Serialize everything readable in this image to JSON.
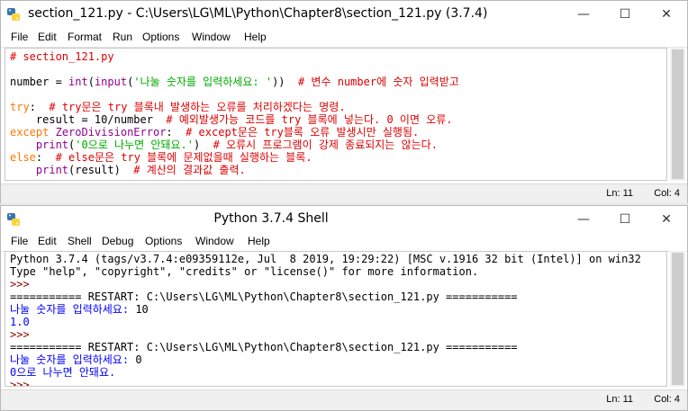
{
  "editor": {
    "title": "section_121.py - C:\\Users\\LG\\ML\\Python\\Chapter8\\section_121.py (3.7.4)",
    "menu": [
      "File",
      "Edit",
      "Format",
      "Run",
      "Options",
      "Window",
      "Help"
    ],
    "code": {
      "l1_cm": "# section_121.py",
      "l3_a": "number = ",
      "l3_bi1": "int",
      "l3_b": "(",
      "l3_bi2": "input",
      "l3_c": "(",
      "l3_str": "'나눌 숫자를 입력하세요: '",
      "l3_d": "))  ",
      "l3_cm": "# 변수 number에 숫자 입력받고",
      "l5_kw": "try",
      "l5_a": ":  ",
      "l5_cm": "# try문은 try 블록내 발생하는 오류를 처리하겠다는 명령.",
      "l6_a": "    result = 10/number  ",
      "l6_cm": "# 예외발생가능 코드를 try 블록에 넣는다. 0 이면 오류.",
      "l7_kw": "except",
      "l7_a": " ",
      "l7_bi": "ZeroDivisionError",
      "l7_b": ":  ",
      "l7_cm": "# except문은 try블록 오류 발생시만 실행됨.",
      "l8_a": "    ",
      "l8_bi": "print",
      "l8_b": "(",
      "l8_str": "'0으로 나누면 안돼요.'",
      "l8_c": ")  ",
      "l8_cm": "# 오류시 프로그램이 강제 종료되지는 않는다.",
      "l9_kw": "else",
      "l9_a": ":  ",
      "l9_cm": "# else문은 try 블록에 문제없을때 실행하는 블록.",
      "l10_a": "    ",
      "l10_bi": "print",
      "l10_b": "(result)  ",
      "l10_cm": "# 계산의 결과값 출력."
    },
    "status": {
      "ln": "Ln: 11",
      "col": "Col: 4"
    }
  },
  "shell": {
    "title": "Python 3.7.4 Shell",
    "menu": [
      "File",
      "Edit",
      "Shell",
      "Debug",
      "Options",
      "Window",
      "Help"
    ],
    "lines": {
      "s1": "Python 3.7.4 (tags/v3.7.4:e09359112e, Jul  8 2019, 19:29:22) [MSC v.1916 32 bit (Intel)] on win32",
      "s2": "Type \"help\", \"copyright\", \"credits\" or \"license()\" for more information.",
      "s3": ">>> ",
      "s4": "=========== RESTART: C:\\Users\\LG\\ML\\Python\\Chapter8\\section_121.py ===========",
      "s5_a": "나눌 숫자를 입력하세요: ",
      "s5_b": "10",
      "s6": "1.0",
      "s7": ">>> ",
      "s8": "=========== RESTART: C:\\Users\\LG\\ML\\Python\\Chapter8\\section_121.py ===========",
      "s9_a": "나눌 숫자를 입력하세요: ",
      "s9_b": "0",
      "s10": "0으로 나누면 안돼요.",
      "s11": ">>> "
    },
    "status": {
      "ln": "Ln: 11",
      "col": "Col: 4"
    }
  },
  "window_controls": {
    "minimize": "—",
    "maximize": "☐",
    "close": "✕"
  },
  "colors": {
    "keyword": "#ff7700",
    "builtin": "#900090",
    "string": "#00aa00",
    "comment": "#dd0000",
    "shell_output": "#0000ff",
    "prompt": "#8b0000"
  }
}
